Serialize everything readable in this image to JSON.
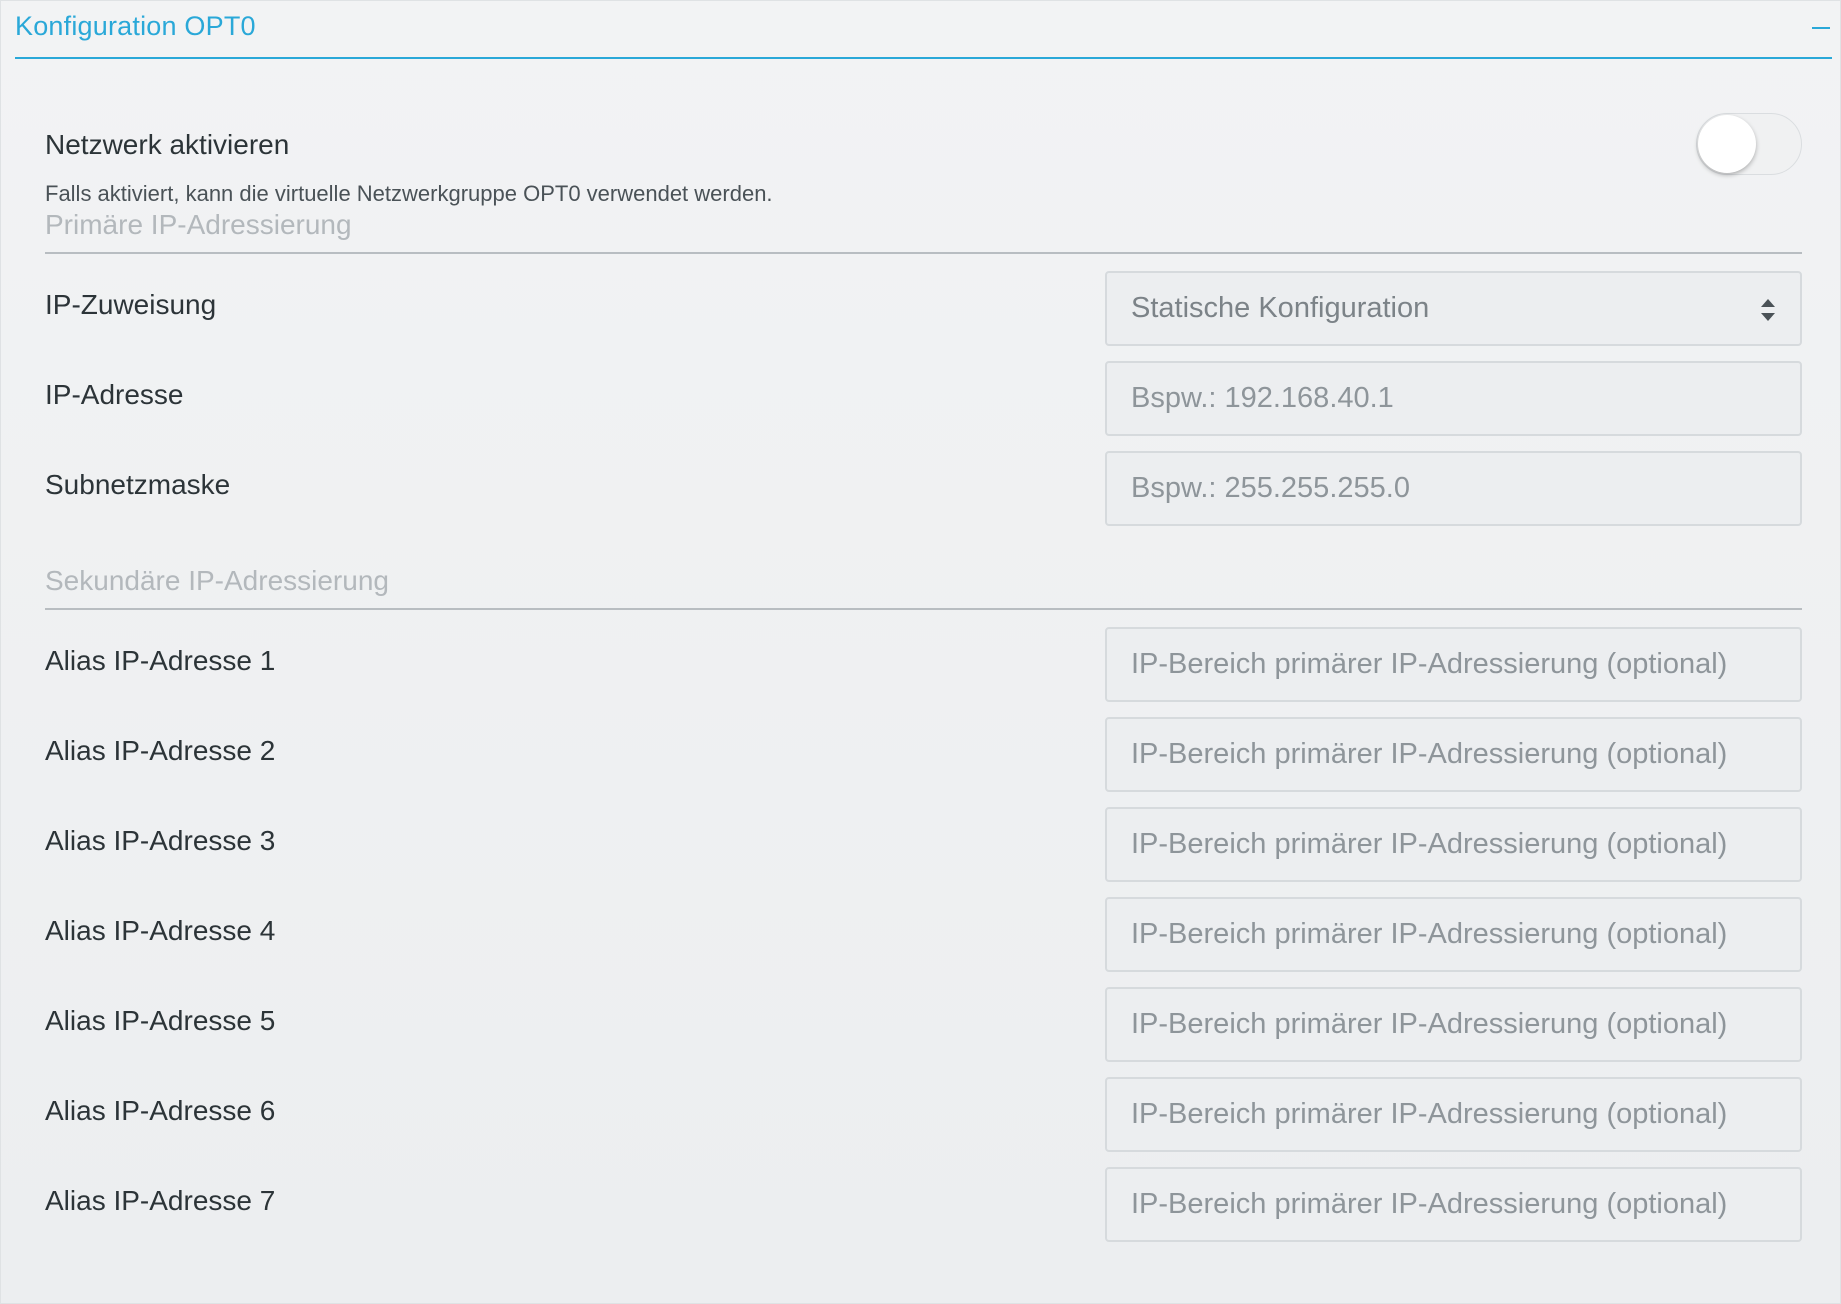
{
  "panel": {
    "title": "Konfiguration OPT0"
  },
  "network": {
    "enable_label": "Netzwerk aktivieren",
    "enable_description": "Falls aktiviert, kann die virtuelle Netzwerkgruppe OPT0 verwendet werden.",
    "enabled": false
  },
  "primary": {
    "section_title": "Primäre IP-Adressierung",
    "ip_assignment": {
      "label": "IP-Zuweisung",
      "value": "Statische Konfiguration"
    },
    "ip_address": {
      "label": "IP-Adresse",
      "placeholder": "Bspw.: 192.168.40.1"
    },
    "subnet_mask": {
      "label": "Subnetzmaske",
      "placeholder": "Bspw.: 255.255.255.0"
    }
  },
  "secondary": {
    "section_title": "Sekundäre IP-Adressierung",
    "aliases": [
      {
        "label": "Alias IP-Adresse 1",
        "placeholder": "IP-Bereich primärer IP-Adressierung (optional)"
      },
      {
        "label": "Alias IP-Adresse 2",
        "placeholder": "IP-Bereich primärer IP-Adressierung (optional)"
      },
      {
        "label": "Alias IP-Adresse 3",
        "placeholder": "IP-Bereich primärer IP-Adressierung (optional)"
      },
      {
        "label": "Alias IP-Adresse 4",
        "placeholder": "IP-Bereich primärer IP-Adressierung (optional)"
      },
      {
        "label": "Alias IP-Adresse 5",
        "placeholder": "IP-Bereich primärer IP-Adressierung (optional)"
      },
      {
        "label": "Alias IP-Adresse 6",
        "placeholder": "IP-Bereich primärer IP-Adressierung (optional)"
      },
      {
        "label": "Alias IP-Adresse 7",
        "placeholder": "IP-Bereich primärer IP-Adressierung (optional)"
      }
    ]
  },
  "colors": {
    "accent": "#2aa8d8",
    "text": "#2c3438",
    "muted": "#b3b8bc"
  },
  "icons": {
    "collapse": "minus-icon",
    "select": "sort-arrows-icon"
  }
}
